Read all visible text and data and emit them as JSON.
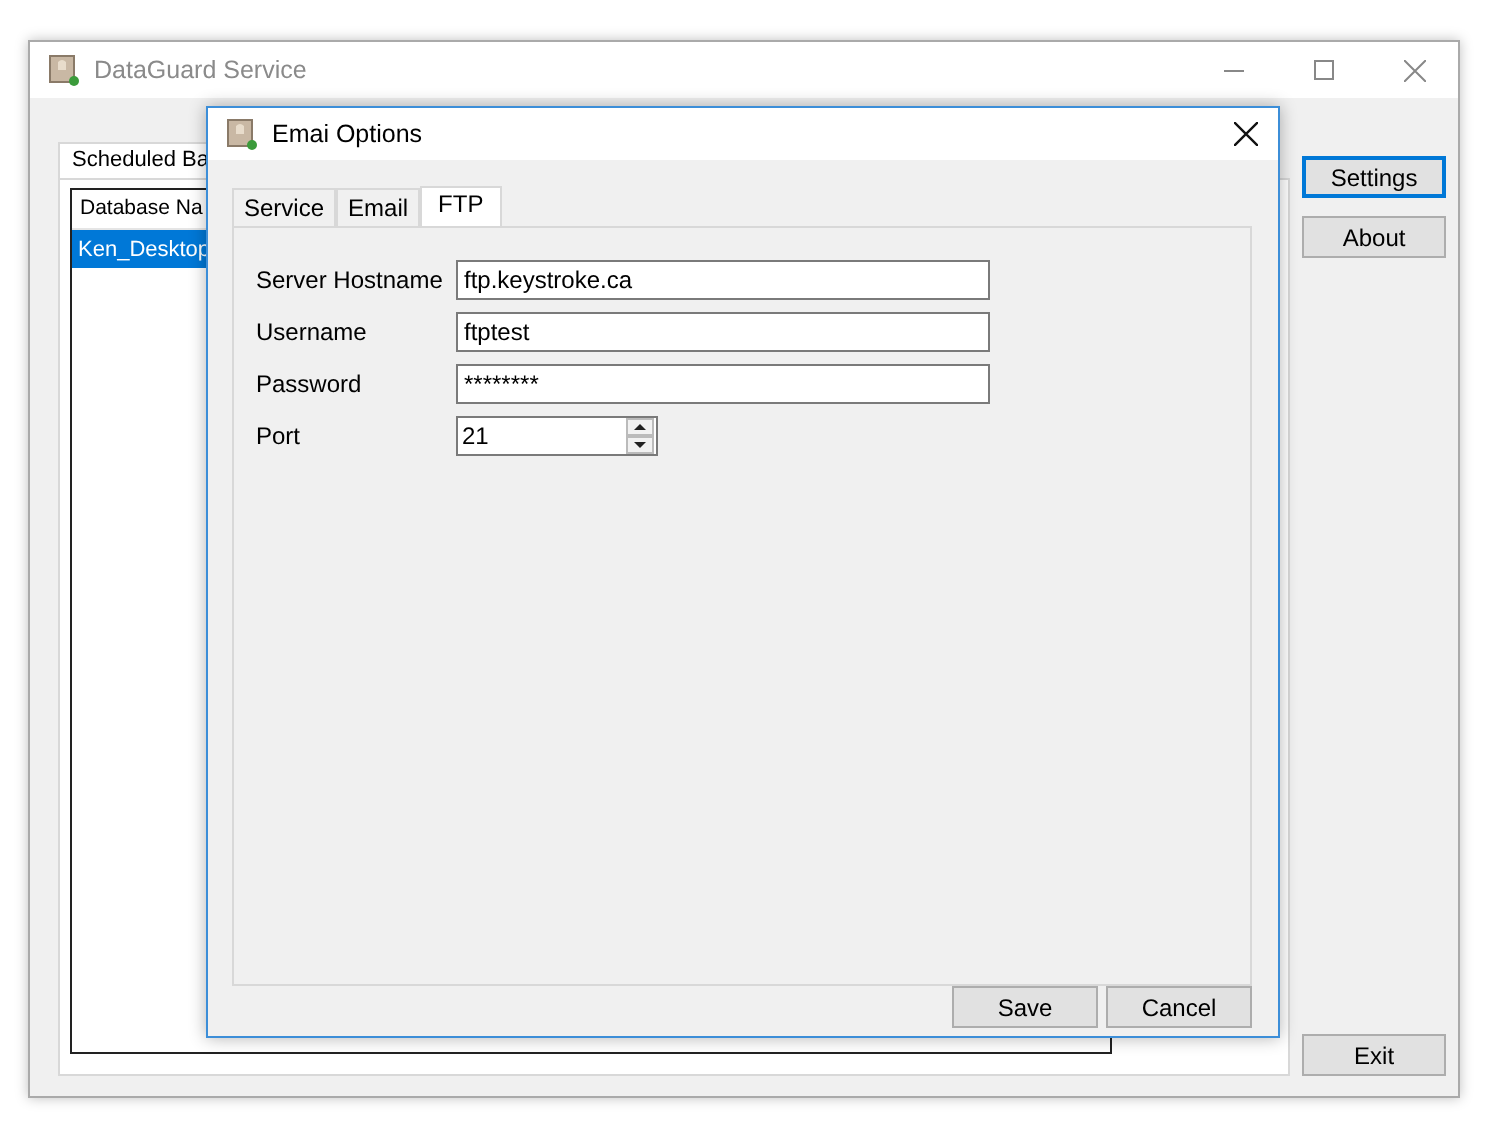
{
  "main_window": {
    "title": "DataGuard Service",
    "tabs": [
      {
        "label": "Scheduled Ba",
        "selected": true
      }
    ],
    "list": {
      "columns": [
        "Database Na"
      ],
      "rows": [
        {
          "cells": [
            "Ken_Desktop"
          ],
          "selected": true
        }
      ]
    },
    "buttons": [
      {
        "label": "Settings",
        "focused": true
      },
      {
        "label": "About",
        "focused": false
      },
      {
        "label": "Exit",
        "focused": false
      }
    ]
  },
  "dialog": {
    "title": "Emai Options",
    "tabs": [
      {
        "label": "Service",
        "selected": false
      },
      {
        "label": "Email",
        "selected": false
      },
      {
        "label": "FTP",
        "selected": true
      }
    ],
    "fields": [
      {
        "label": "Server Hostname",
        "value": "ftp.keystroke.ca",
        "kind": "text"
      },
      {
        "label": "Username",
        "value": "ftptest",
        "kind": "text"
      },
      {
        "label": "Password",
        "value": "********",
        "kind": "text"
      },
      {
        "label": "Port",
        "value": "21",
        "kind": "spinner"
      }
    ],
    "buttons": [
      "Save",
      "Cancel"
    ]
  }
}
